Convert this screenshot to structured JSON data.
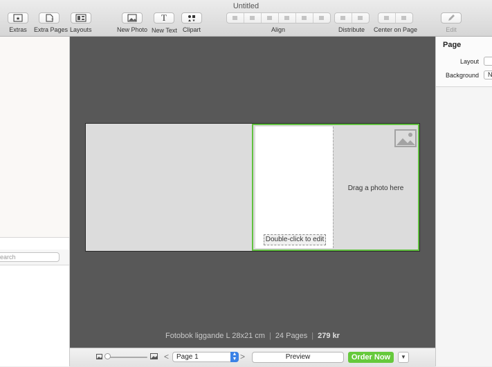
{
  "window": {
    "title": "Untitled"
  },
  "toolbar": {
    "extras": "Extras",
    "extra_pages": "Extra Pages",
    "layouts": "Layouts",
    "new_photo": "New Photo",
    "new_text": "New Text",
    "clipart": "Clipart",
    "align": "Align",
    "distribute": "Distribute",
    "center_on_page": "Center on Page",
    "edit": "Edit",
    "new_text_glyph": "T"
  },
  "sidebar": {
    "search_placeholder": "Search"
  },
  "canvas": {
    "photo_placeholder": "Drag a photo here",
    "text_placeholder": "Double-click to edit",
    "product": "Fotobok liggande L 28x21 cm",
    "pages": "24 Pages",
    "price": "279 kr",
    "separator": "|"
  },
  "bottombar": {
    "page_selected": "Page 1",
    "preview": "Preview",
    "order_now": "Order Now",
    "prev_glyph": "<",
    "next_glyph": ">"
  },
  "inspector": {
    "title": "Page",
    "layout_label": "Layout",
    "background_label": "Background",
    "background_value": "N"
  },
  "colors": {
    "accent_green": "#66c93c",
    "selection_border": "#62c141",
    "canvas_bg": "#585858",
    "stepper_blue": "#3b82e6"
  }
}
